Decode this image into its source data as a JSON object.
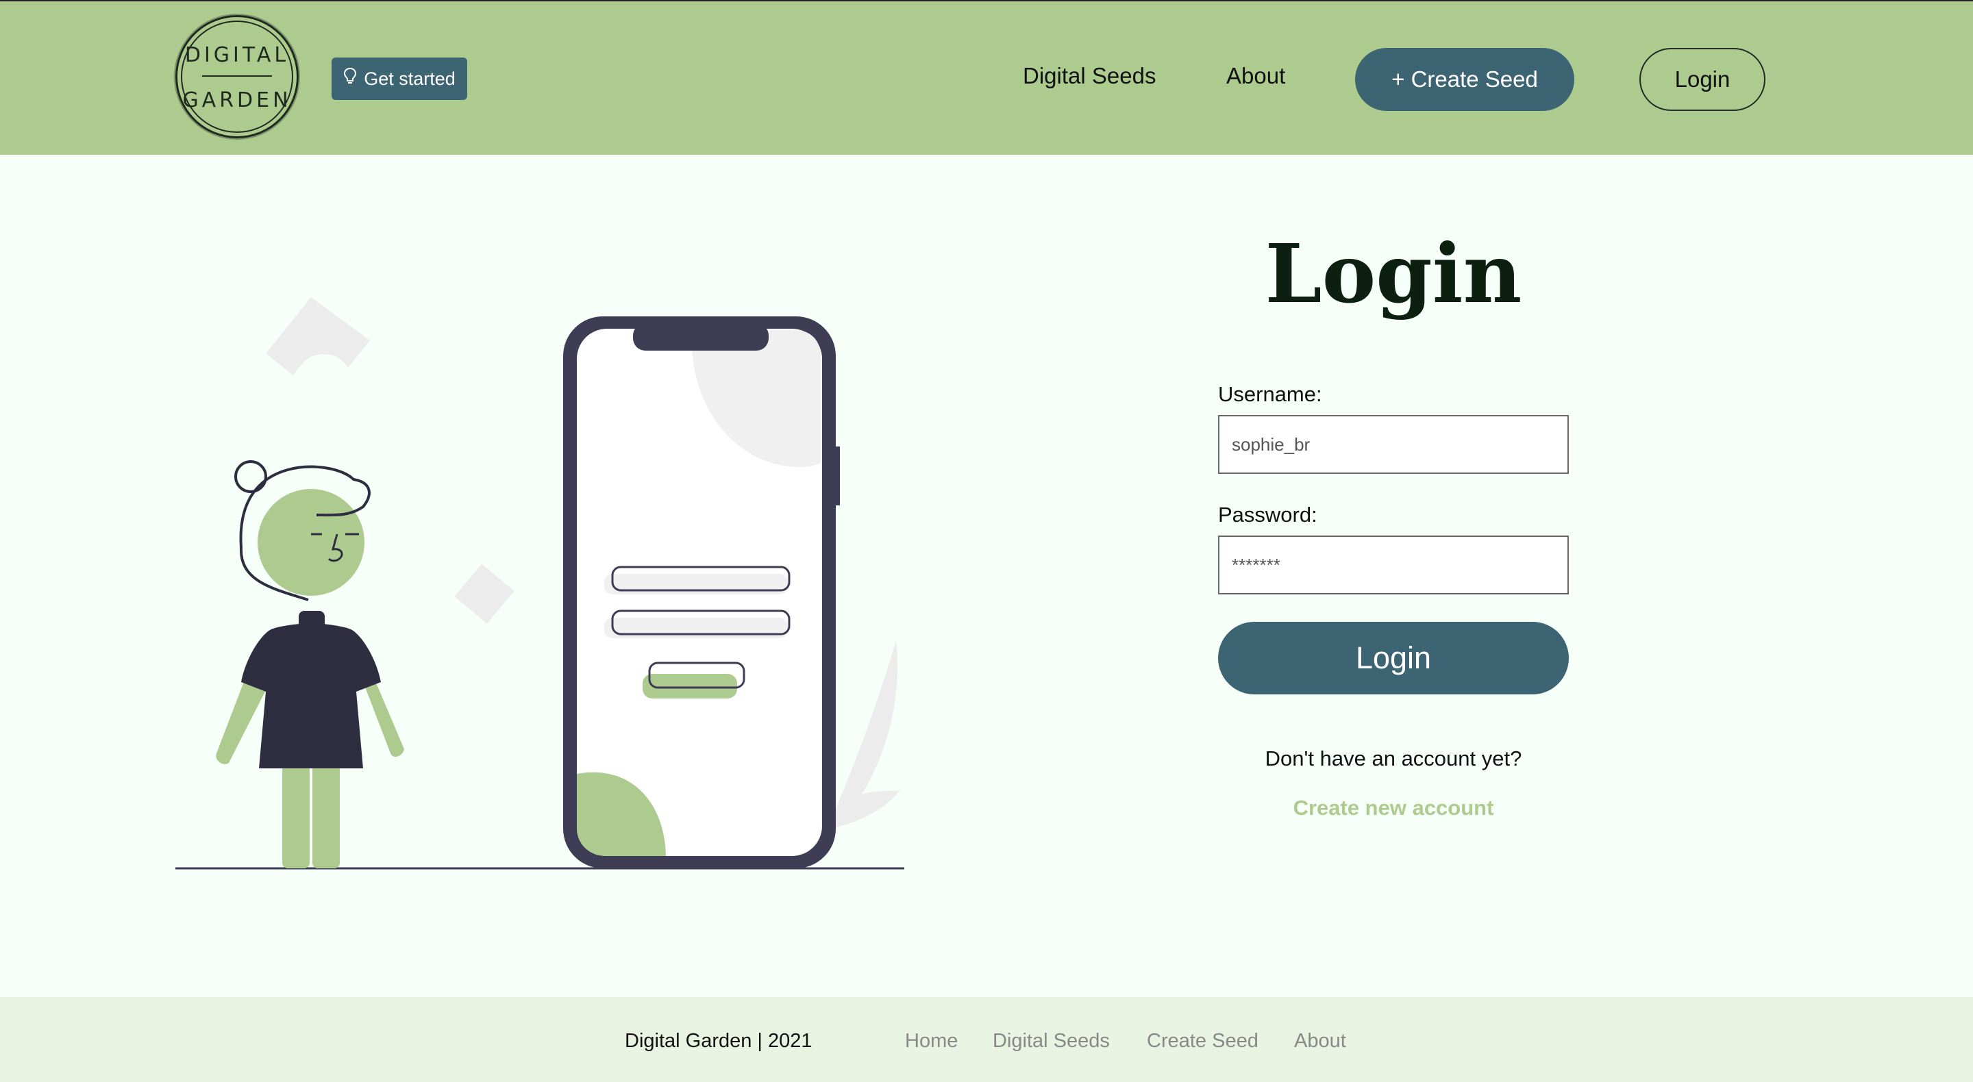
{
  "header": {
    "logo": {
      "line1": "DIGITAL",
      "line2": "GARDEN"
    },
    "get_started": {
      "label": "Get started",
      "icon": "lightbulb-icon"
    },
    "nav": {
      "digital_seeds": "Digital Seeds",
      "about": "About"
    },
    "create_seed": "+ Create Seed",
    "login": "Login"
  },
  "login_form": {
    "title": "Login",
    "username_label": "Username:",
    "username_value": "sophie_br",
    "password_label": "Password:",
    "password_value": "*******",
    "submit_label": "Login",
    "no_account_text": "Don't have an account yet?",
    "create_account_link": "Create new account"
  },
  "footer": {
    "copyright": "Digital Garden | 2021",
    "links": [
      "Home",
      "Digital Seeds",
      "Create Seed",
      "About"
    ]
  },
  "colors": {
    "header_bg": "#aecb8f",
    "accent_dark": "#3d6472",
    "page_bg": "#f7fff9",
    "footer_bg": "#e9f3e2",
    "link_green": "#aecb8f"
  }
}
